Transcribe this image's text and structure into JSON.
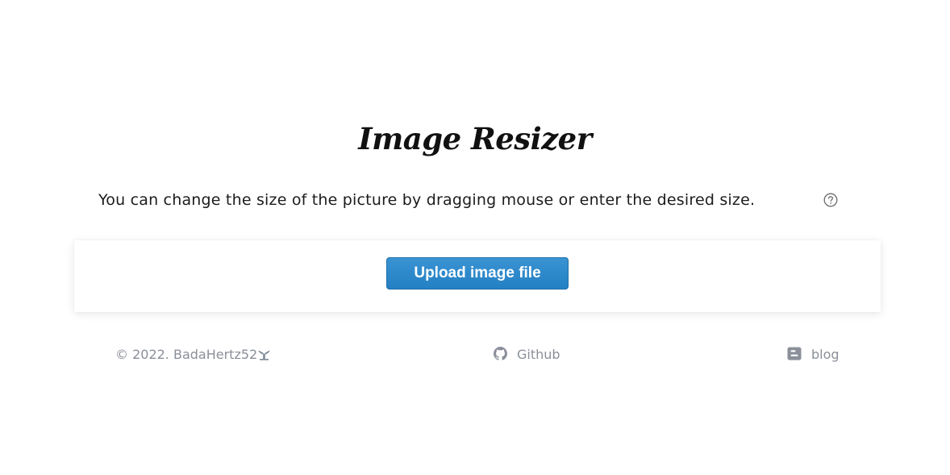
{
  "header": {
    "title": "Image Resizer"
  },
  "instructions": {
    "text": "You can change the size of the picture by dragging mouse or enter the desired size.",
    "help_icon": "question-circle-icon"
  },
  "upload": {
    "button_label": "Upload image file",
    "button_color": "#2a86c8"
  },
  "footer": {
    "copyright": "© 2022. BadaHertz52",
    "copyright_icon": "whale-tail-icon",
    "github_label": "Github",
    "github_icon": "github-icon",
    "blog_label": "blog",
    "blog_icon": "blogger-icon",
    "text_color": "#8a8f99"
  }
}
